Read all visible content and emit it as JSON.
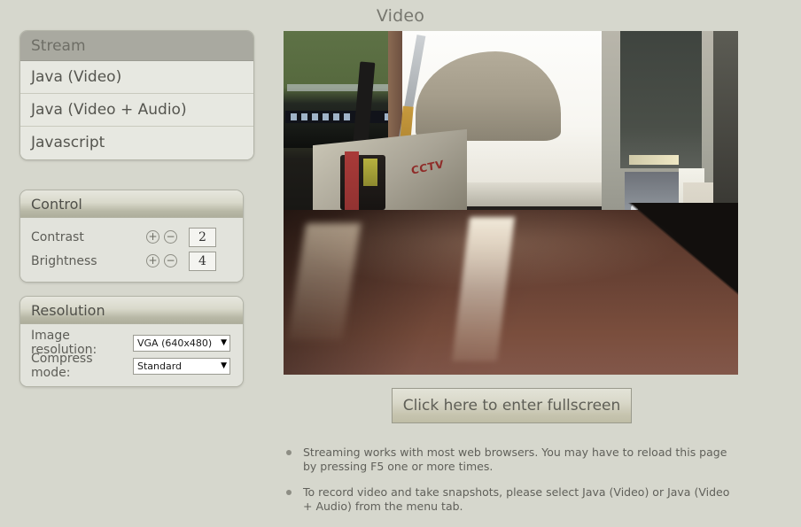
{
  "page": {
    "title": "Video",
    "background_color": "#d6d7cd"
  },
  "stream_menu": {
    "header": "Stream",
    "items": [
      {
        "label": "Java (Video)"
      },
      {
        "label": "Java (Video + Audio)"
      },
      {
        "label": "Javascript"
      }
    ]
  },
  "control_panel": {
    "header": "Control",
    "rows": [
      {
        "label": "Contrast",
        "plus": "+",
        "minus": "−",
        "value": "2"
      },
      {
        "label": "Brightness",
        "plus": "+",
        "minus": "−",
        "value": "4"
      }
    ]
  },
  "resolution_panel": {
    "header": "Resolution",
    "rows": [
      {
        "label": "Image resolution:",
        "value": "VGA (640x480)",
        "arrow": "▼"
      },
      {
        "label": "Compress mode:",
        "value": "Standard",
        "arrow": "▼"
      }
    ]
  },
  "video": {
    "alt": "live-webcam-stream",
    "scene": "desk with CCTV box, pen cup, monitor, window, model car on shelf"
  },
  "fullscreen_button": {
    "label": "Click here to enter fullscreen"
  },
  "notes": [
    {
      "text": "Streaming works with most web browsers. You may have to reload this page by pressing F5 one or more times."
    },
    {
      "text": "To record video and take snapshots, please select Java (Video) or Java (Video + Audio) from the menu tab."
    }
  ]
}
